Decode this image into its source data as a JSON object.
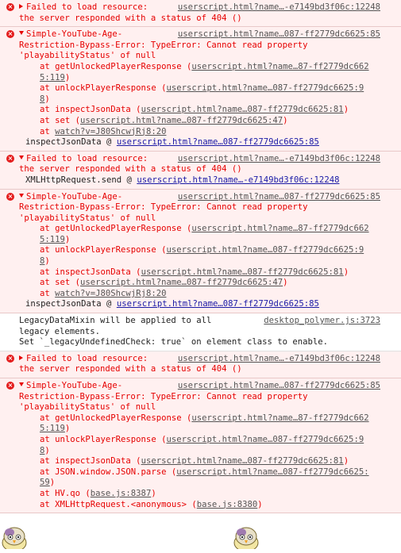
{
  "messages": [
    {
      "type": "error",
      "expanded": false,
      "lines": [
        "Failed to load resource:",
        "the server responded with a status of 404 ()"
      ],
      "source": "userscript.html?name…-e7149bd3f06c:12248"
    },
    {
      "type": "error",
      "expanded": true,
      "lines": [
        "Simple-YouTube-Age-",
        "Restriction-Bypass-Error: TypeError: Cannot read property",
        "'playabilityStatus' of null"
      ],
      "source": "userscript.html?name…087-ff2779dc6625:85",
      "frames": [
        {
          "fn": "at getUnlockedPlayerResponse (",
          "loc": "userscript.html?name…87-ff2779dc662",
          "cont": "5:119",
          "tail": ")"
        },
        {
          "fn": "at unlockPlayerResponse (",
          "loc": "userscript.html?name…087-ff2779dc6625:9",
          "cont": "8",
          "tail": ")"
        },
        {
          "fn": "at inspectJsonData (",
          "loc": "userscript.html?name…087-ff2779dc6625:81",
          "cont": "",
          "tail": ")"
        },
        {
          "fn": "at set (",
          "loc": "userscript.html?name…087-ff2779dc6625:47",
          "cont": "",
          "tail": ")"
        },
        {
          "fn": "at ",
          "loc": "watch?v=J80ShcwjRj8:20",
          "cont": "",
          "tail": ""
        }
      ],
      "sub": {
        "label": "inspectJsonData @ ",
        "link": "userscript.html?name…087-ff2779dc6625:85"
      }
    },
    {
      "type": "error",
      "expanded": true,
      "lines": [
        "Failed to load resource:",
        "the server responded with a status of 404 ()"
      ],
      "source": "userscript.html?name…-e7149bd3f06c:12248",
      "sub": {
        "label": "XMLHttpRequest.send @ ",
        "link": "userscript.html?name…-e7149bd3f06c:12248"
      }
    },
    {
      "type": "error",
      "expanded": true,
      "lines": [
        "Simple-YouTube-Age-",
        "Restriction-Bypass-Error: TypeError: Cannot read property",
        "'playabilityStatus' of null"
      ],
      "source": "userscript.html?name…087-ff2779dc6625:85",
      "frames": [
        {
          "fn": "at getUnlockedPlayerResponse (",
          "loc": "userscript.html?name…87-ff2779dc662",
          "cont": "5:119",
          "tail": ")"
        },
        {
          "fn": "at unlockPlayerResponse (",
          "loc": "userscript.html?name…087-ff2779dc6625:9",
          "cont": "8",
          "tail": ")"
        },
        {
          "fn": "at inspectJsonData (",
          "loc": "userscript.html?name…087-ff2779dc6625:81",
          "cont": "",
          "tail": ")"
        },
        {
          "fn": "at set (",
          "loc": "userscript.html?name…087-ff2779dc6625:47",
          "cont": "",
          "tail": ")"
        },
        {
          "fn": "at ",
          "loc": "watch?v=J80ShcwjRj8:20",
          "cont": "",
          "tail": ""
        }
      ],
      "sub": {
        "label": "inspectJsonData @ ",
        "link": "userscript.html?name…087-ff2779dc6625:85"
      }
    },
    {
      "type": "info",
      "lines": [
        "LegacyDataMixin will be applied to all",
        "legacy elements.",
        "Set `_legacyUndefinedCheck: true` on element class to enable."
      ],
      "source": "desktop_polymer.js:3723"
    },
    {
      "type": "error",
      "expanded": false,
      "lines": [
        "Failed to load resource:",
        "the server responded with a status of 404 ()"
      ],
      "source": "userscript.html?name…-e7149bd3f06c:12248"
    },
    {
      "type": "error",
      "expanded": true,
      "lines": [
        "Simple-YouTube-Age-",
        "Restriction-Bypass-Error: TypeError: Cannot read property",
        "'playabilityStatus' of null"
      ],
      "source": "userscript.html?name…087-ff2779dc6625:85",
      "frames": [
        {
          "fn": "at getUnlockedPlayerResponse (",
          "loc": "userscript.html?name…87-ff2779dc662",
          "cont": "5:119",
          "tail": ")"
        },
        {
          "fn": "at unlockPlayerResponse (",
          "loc": "userscript.html?name…087-ff2779dc6625:9",
          "cont": "8",
          "tail": ")"
        },
        {
          "fn": "at inspectJsonData (",
          "loc": "userscript.html?name…087-ff2779dc6625:81",
          "cont": "",
          "tail": ")"
        },
        {
          "fn": "at JSON.window.JSON.parse (",
          "loc": "userscript.html?name…087-ff2779dc6625:",
          "cont": "59",
          "tail": ")"
        },
        {
          "fn": "at HV.qo (",
          "loc": "base.js:8387",
          "cont": "",
          "tail": ")"
        },
        {
          "fn": "at XMLHttpRequest.<anonymous> (",
          "loc": "base.js:8380",
          "cont": "",
          "tail": ")"
        }
      ]
    }
  ],
  "colors": {
    "error_text": "#e60000",
    "error_bg": "#fff0f0",
    "link": "#1a1aa6"
  }
}
